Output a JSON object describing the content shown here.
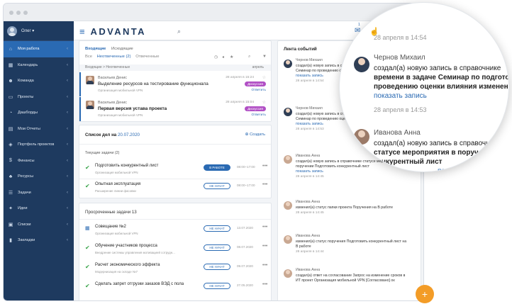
{
  "sidebar": {
    "user_name": "Олег ▾",
    "items": [
      {
        "label": "Моя работа",
        "icon": "home-icon",
        "glyph": "⌂",
        "active": true
      },
      {
        "label": "Календарь",
        "icon": "calendar-icon",
        "glyph": "▦"
      },
      {
        "label": "Команда",
        "icon": "team-icon",
        "glyph": "☻"
      },
      {
        "label": "Проекты",
        "icon": "projects-icon",
        "glyph": "▭"
      },
      {
        "label": "Дашборды",
        "icon": "dashboard-icon",
        "glyph": "◔"
      },
      {
        "label": "Мои Отчеты",
        "icon": "reports-icon",
        "glyph": "▤"
      },
      {
        "label": "Портфель проектов",
        "icon": "portfolio-icon",
        "glyph": "◈"
      },
      {
        "label": "Финансы",
        "icon": "finance-icon",
        "glyph": "$"
      },
      {
        "label": "Ресурсы",
        "icon": "resources-icon",
        "glyph": "♣"
      },
      {
        "label": "Задачи",
        "icon": "tasks-icon",
        "glyph": "☰"
      },
      {
        "label": "Идеи",
        "icon": "ideas-icon",
        "glyph": "✦"
      },
      {
        "label": "Списки",
        "icon": "lists-icon",
        "glyph": "▣"
      },
      {
        "label": "Закладки",
        "icon": "bookmarks-icon",
        "glyph": "▮"
      }
    ]
  },
  "topbar": {
    "logo_prefix": "≡",
    "logo": "ADVANTA",
    "mail_badge": "1"
  },
  "inbox": {
    "tabs": [
      "Входящие",
      "Исходящие"
    ],
    "filters": [
      "Все",
      "Неотвеченные (2)",
      "Отвеченные"
    ],
    "breadcrumb": "Входящие  >  Неотвеченные",
    "month": "апрель",
    "messages": [
      {
        "author": "Васильев Денис",
        "subject": "Выделение ресурсов на тестирование функционала",
        "org": "Организация мобильной VPN",
        "date": "28 апреля в 15:24",
        "tag": "Дискуссия",
        "reply": "Ответить",
        "bold": false
      },
      {
        "author": "Васильев Денис",
        "subject": "Первая версия устава проекта",
        "org": "Организация мобильной VPN",
        "date": "28 апреля в 15:04",
        "tag": "Дискуссия",
        "reply": "Ответить",
        "bold": true
      }
    ]
  },
  "tasks": {
    "title": "Список дел на",
    "date": "20.07.2020",
    "create_label": "Создать",
    "current_label": "Текущие задачи (2)",
    "current": [
      {
        "title": "Подготовить конкурентный лист",
        "sub": "Организация мобильной VPN",
        "status": "В РАБОТЕ",
        "time": "08:00–17:00",
        "filled": true
      },
      {
        "title": "Опытная эксплуатация",
        "sub": "Расширение линии фасовки",
        "status": "НЕ НАЧАТ",
        "time": "08:00–17:00",
        "filled": false
      }
    ],
    "overdue_label": "Просроченные задачи 13",
    "overdue": [
      {
        "title": "Совещание №2",
        "sub": "Организация мобильной VPN",
        "status": "НЕ НАЧАТ",
        "date": "13.07.2020",
        "icon": "calendar"
      },
      {
        "title": "Обучение участников процесса",
        "sub": "Внедрение системы управления мотивацией сотрудн...",
        "status": "НЕ НАЧАТ",
        "date": "08.07.2020",
        "icon": "check"
      },
      {
        "title": "Расчет экономического эффекта",
        "sub": "Модернизация на складе №7",
        "status": "НЕ НАЧАТ",
        "date": "09.07.2020",
        "icon": "check"
      },
      {
        "title": "Сделать запрет отгрузки заказов ВЭД с пола",
        "sub": "",
        "status": "НЕ НАЧАТ",
        "date": "27.05.2020",
        "icon": "check"
      }
    ]
  },
  "feed": {
    "title": "Лента событий",
    "events": [
      {
        "name": "Чернов Михаил",
        "text": "создал(а) новую запись в справочнике времени в задаче Семинар по проведению оценки влияния",
        "link": "показать запись",
        "date": "28 апреля в 14:54",
        "man": true
      },
      {
        "name": "Чернов Михаил",
        "text": "создал(а) новую запись в справочнике времени в задаче Семинар по проведению оценки влияния",
        "link": "показать запись",
        "date": "28 апреля в 14:53",
        "man": true
      },
      {
        "name": "Иванова Анна",
        "text": "создал(а) новую запись в справочнике статусе мероприятия в поручении Подготовить конкурентный лист",
        "link": "показать запись",
        "date": "28 апреля в 14:45",
        "man": false
      },
      {
        "name": "Иванова Анна",
        "text": "изменил(а) статус папки проекта Поручения на В работе",
        "link": "",
        "date": "28 апреля в 14:45",
        "man": false
      },
      {
        "name": "Иванова Анна",
        "text": "изменил(а) статус поручения Подготовить конкурентный лист на В работе",
        "link": "",
        "date": "28 апреля в 14:44",
        "man": false
      },
      {
        "name": "Иванова Анна",
        "text": "создал(а) ответ на согласование Запрос на изменение сроков в ИТ проект Организация мобильной VPN [Согласовано] ок",
        "link": "",
        "date": "",
        "man": false
      }
    ]
  },
  "magnifier": {
    "date_top": "28 апреля в 14:54",
    "entry1_name": "Чернов Михаил",
    "entry1_line1": "создал(а) новую запись в справочнике",
    "entry1_line2": "времени в задаче Семинар по подготовке",
    "entry1_line3": "проведению оценки влияния изменений",
    "entry1_link": "показать запись",
    "entry1_date": "28 апреля в 14:53",
    "entry2_name": "Иванова Анна",
    "entry2_line1": "создал(а) новую запись в справочнике",
    "entry2_line2": "статусе мероприятия в поручении П",
    "entry2_line3": "конкурентный лист",
    "entry2_link": "показать запись"
  }
}
